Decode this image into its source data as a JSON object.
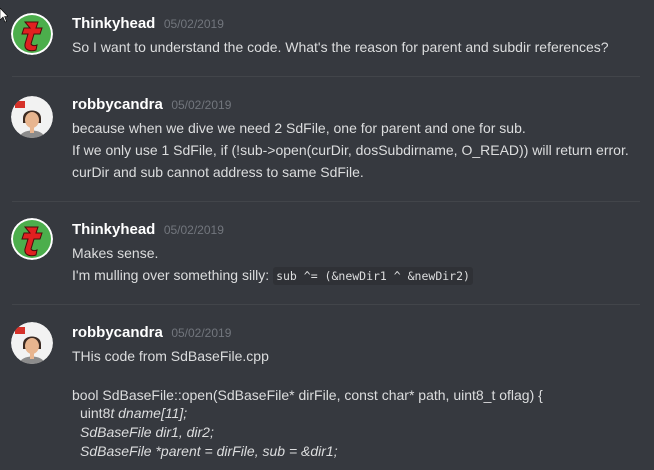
{
  "messages": [
    {
      "author": "Thinkyhead",
      "timestamp": "05/02/2019",
      "lines": [
        "So I want to understand the code. What's the reason for parent and subdir references?"
      ]
    },
    {
      "author": "robbycandra",
      "timestamp": "05/02/2019",
      "lines": [
        "because when we dive we need 2 SdFile, one for parent and one for sub.",
        "If we only use 1 SdFile,  if (!sub->open(curDir, dosSubdirname, O_READ))  will return error.",
        "curDir and sub cannot address to same SdFile."
      ]
    },
    {
      "author": "Thinkyhead",
      "timestamp": "05/02/2019",
      "lines": [
        "Makes sense."
      ],
      "inline_prefix": "I'm mulling over something silly:",
      "inline_code": "sub ^= (&newDir1 ^ &newDir2)"
    },
    {
      "author": "robbycandra",
      "timestamp": "05/02/2019",
      "lines": [
        "THis code from SdBaseFile.cpp"
      ],
      "code_lines": {
        "l1": "bool SdBaseFile::open(SdBaseFile* dirFile, const char* path, uint8_t oflag) {",
        "l2a": "uint8",
        "l2b": "t dname[11];",
        "l3": "SdBaseFile dir1, dir2;",
        "l4": "SdBaseFile *parent = dirFile, sub = &dir1;"
      }
    }
  ],
  "colors": {
    "background": "#36393f",
    "username": "#ffffff",
    "timestamp": "#72767d",
    "text": "#dcddde"
  }
}
